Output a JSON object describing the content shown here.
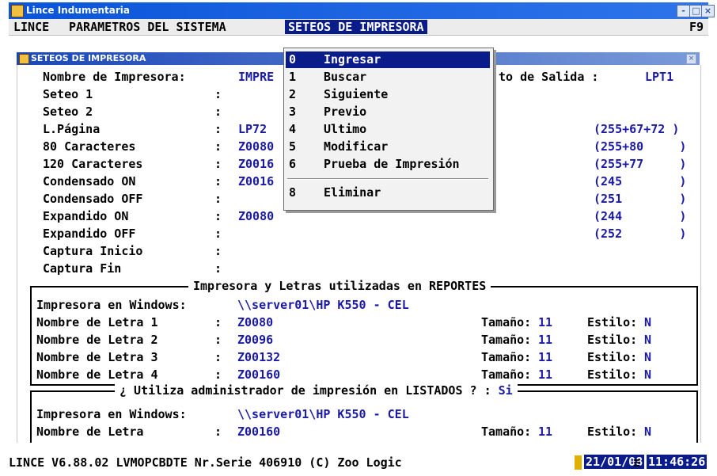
{
  "window": {
    "title": "Lince Indumentaria",
    "btn_min": "-",
    "btn_max": "□",
    "btn_close": "×"
  },
  "menubar": {
    "items": [
      "LINCE",
      "PARAMETROS DEL SISTEMA",
      "SETEOS DE IMPRESORA"
    ],
    "shortcut": "F9"
  },
  "inner": {
    "title": "SETEOS DE IMPRESORA",
    "close": "×"
  },
  "fields": {
    "nombre_label": "Nombre de Impresora:",
    "nombre_value": "IMPRE",
    "salida_label": "to de Salida :",
    "salida_value": "LPT1",
    "rows": [
      {
        "label": "Seteo 1",
        "colon": ":",
        "value": "",
        "code": ""
      },
      {
        "label": "Seteo 2",
        "colon": ":",
        "value": "",
        "code": ""
      },
      {
        "label": "L.Página",
        "colon": ":",
        "value": "LP72",
        "code": "(255+67+72 )"
      },
      {
        "label": "80 Caracteres",
        "colon": ":",
        "value": "Z0080",
        "code": "(255+80     )"
      },
      {
        "label": "120 Caracteres",
        "colon": ":",
        "value": "Z0016",
        "code": "(255+77     )"
      },
      {
        "label": "Condensado ON",
        "colon": ":",
        "value": "Z0016",
        "code": "(245        )"
      },
      {
        "label": "Condensado OFF",
        "colon": ":",
        "value": "",
        "code": "(251        )"
      },
      {
        "label": "Expandido ON",
        "colon": ":",
        "value": "Z0080",
        "code": "(244        )"
      },
      {
        "label": "Expandido OFF",
        "colon": ":",
        "value": "",
        "code": "(252        )"
      },
      {
        "label": "Captura Inicio",
        "colon": ":",
        "value": "",
        "code": ""
      },
      {
        "label": "Captura Fin",
        "colon": ":",
        "value": "",
        "code": ""
      }
    ]
  },
  "reportes": {
    "title": "Impresora y Letras utilizadas en REPORTES",
    "printer_label": "Impresora en Windows:",
    "printer_value": "\\\\server01\\HP K550 - CEL",
    "letters": [
      {
        "label": "Nombre de Letra 1",
        "value": "Z0080",
        "size_label": "Tamaño:",
        "size": "11",
        "style_label": "Estilo:",
        "style": "N"
      },
      {
        "label": "Nombre de Letra 2",
        "value": "Z0096",
        "size_label": "Tamaño:",
        "size": "11",
        "style_label": "Estilo:",
        "style": "N"
      },
      {
        "label": "Nombre de Letra 3",
        "value": "Z00132",
        "size_label": "Tamaño:",
        "size": "11",
        "style_label": "Estilo:",
        "style": "N"
      },
      {
        "label": "Nombre de Letra 4",
        "value": "Z00160",
        "size_label": "Tamaño:",
        "size": "11",
        "style_label": "Estilo:",
        "style": "N"
      }
    ]
  },
  "listados": {
    "title": "¿ Utiliza administrador de impresión en LISTADOS ? :",
    "answer": "Si",
    "printer_label": "Impresora en Windows:",
    "printer_value": "\\\\server01\\HP K550 - CEL",
    "letter_label": "Nombre de Letra",
    "letter_value": "Z00160",
    "size_label": "Tamaño:",
    "size": "11",
    "style_label": "Estilo:",
    "style": "N"
  },
  "dropdown": {
    "items": [
      {
        "num": "0",
        "label": "Ingresar"
      },
      {
        "num": "1",
        "label": "Buscar"
      },
      {
        "num": "2",
        "label": "Siguiente"
      },
      {
        "num": "3",
        "label": "Previo"
      },
      {
        "num": "4",
        "label": "Ultimo"
      },
      {
        "num": "5",
        "label": "Modificar"
      },
      {
        "num": "6",
        "label": "Prueba de Impresión"
      },
      {
        "num": "8",
        "label": "Eliminar"
      }
    ]
  },
  "status": {
    "text": "LINCE  V6.88.02  LVMOPCBDTE Nr.Serie 406910 (C) Zoo Logic",
    "date": "21/01/08",
    "eq": "≡",
    "time": "11:46:26"
  },
  "colors": {
    "title_bar": "#0a55d8",
    "menu_active": "#0a1b8a",
    "value_text": "#1a1aa6"
  }
}
